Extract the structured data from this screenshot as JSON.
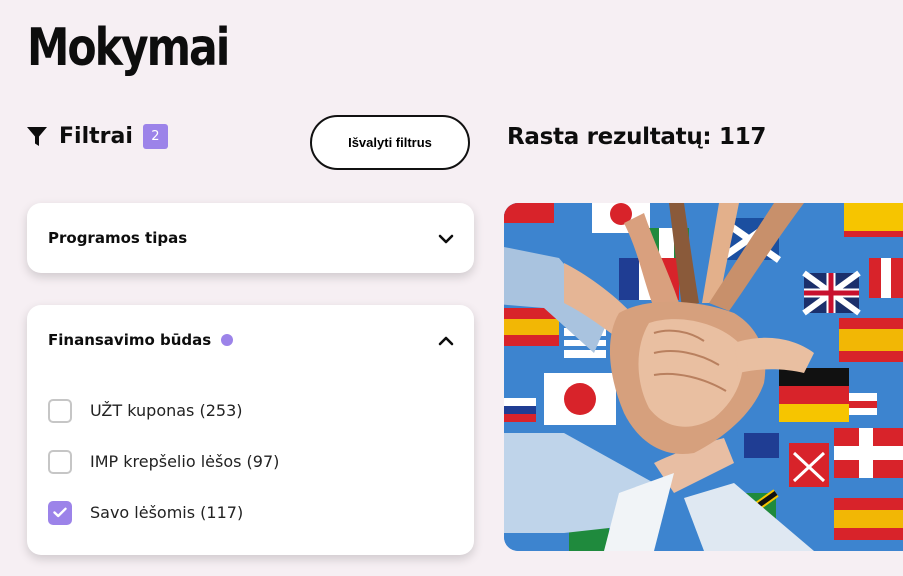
{
  "page": {
    "title": "Mokymai"
  },
  "filters": {
    "title": "Filtrai",
    "active_count": "2",
    "clear_label": "Išvalyti filtrus",
    "groups": [
      {
        "title": "Programos tipas",
        "expanded": false,
        "has_active": false
      },
      {
        "title": "Finansavimo būdas",
        "expanded": true,
        "has_active": true,
        "options": [
          {
            "label": "UŽT kuponas (253)",
            "checked": false
          },
          {
            "label": "IMP krepšelio lėšos (97)",
            "checked": false
          },
          {
            "label": "Savo lėšomis (117)",
            "checked": true
          }
        ]
      }
    ]
  },
  "results": {
    "label": "Rasta rezultatų: 117"
  },
  "icons": {
    "filter": "filter-funnel-icon",
    "expand": "chevron-down-icon",
    "collapse": "chevron-up-icon",
    "check": "check-icon"
  },
  "colors": {
    "accent": "#9c83e9",
    "background": "#f6eff3",
    "text": "#0d0d0d",
    "card": "#ffffff"
  }
}
